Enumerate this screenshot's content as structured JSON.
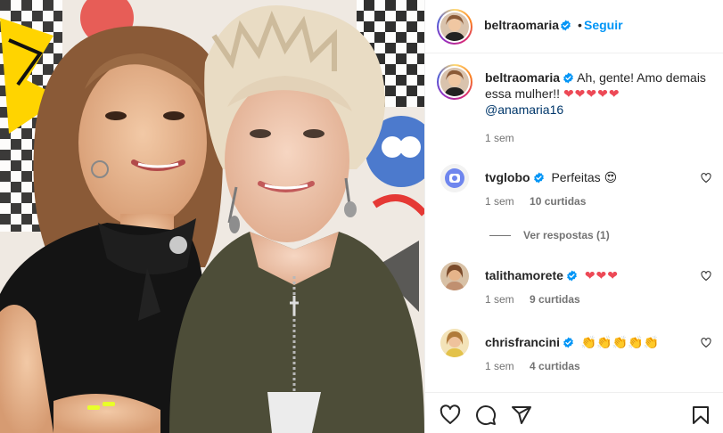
{
  "post": {
    "author": "beltraomaria",
    "follow_label": "Seguir",
    "dot": "•"
  },
  "caption": {
    "author": "beltraomaria",
    "text": "Ah, gente! Amo demais essa mulher!!",
    "emojis": "❤❤❤❤❤",
    "mention": "@anamaria16",
    "time": "1 sem"
  },
  "comments": [
    {
      "user": "tvglobo",
      "verified": true,
      "text": "Perfeitas",
      "emojis": "😍",
      "time": "1 sem",
      "likes": "10 curtidas",
      "avatar_color": "#7a8cf0"
    },
    {
      "user": "talithamorete",
      "verified": true,
      "text": "",
      "emojis": "❤❤❤",
      "time": "1 sem",
      "likes": "9 curtidas",
      "avatar_color": "#c89b6a"
    },
    {
      "user": "chrisfrancini",
      "verified": true,
      "text": "",
      "emojis": "👏👏👏👏👏",
      "time": "1 sem",
      "likes": "4 curtidas",
      "avatar_color": "#e2b06a"
    }
  ],
  "view_replies": "Ver respostas (1)",
  "icons": [
    "heart-icon",
    "comment-icon",
    "share-icon",
    "bookmark-icon",
    "verified-icon"
  ],
  "colors": {
    "accent": "#0095f6",
    "verified": "#0095f6",
    "heart": "#ed4956",
    "text": "#262626",
    "muted": "#737373"
  }
}
